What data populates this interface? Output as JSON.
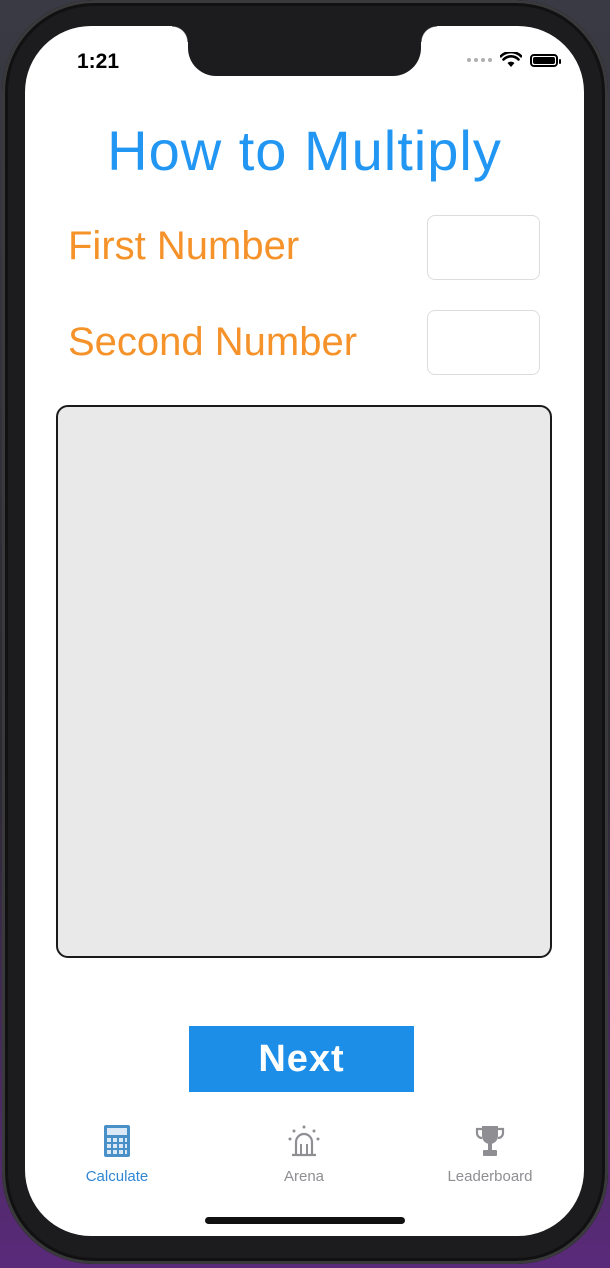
{
  "status_bar": {
    "time": "1:21"
  },
  "main": {
    "title": "How to Multiply",
    "first_label": "First Number",
    "second_label": "Second Number",
    "first_value": "",
    "second_value": "",
    "next_label": "Next"
  },
  "tabbar": {
    "items": [
      {
        "label": "Calculate",
        "icon": "calculator-icon",
        "active": true
      },
      {
        "label": "Arena",
        "icon": "arena-icon",
        "active": false
      },
      {
        "label": "Leaderboard",
        "icon": "trophy-icon",
        "active": false
      }
    ]
  },
  "colors": {
    "title": "#2196f3",
    "labels": "#f5922a",
    "button": "#1c8ee8",
    "tab_active": "#2f86d4",
    "tab_inactive": "#8e8e93",
    "work_area": "#e9e9e9"
  }
}
